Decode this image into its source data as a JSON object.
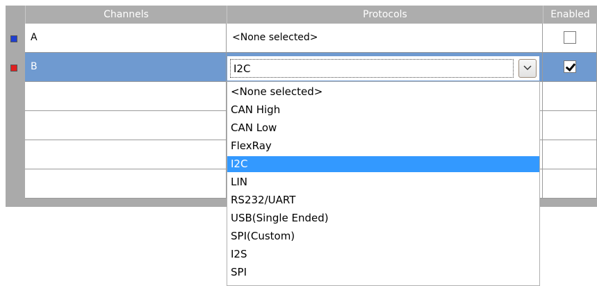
{
  "columns": {
    "channels": "Channels",
    "protocols": "Protocols",
    "enabled": "Enabled"
  },
  "rows": [
    {
      "channel": "A",
      "protocol": "<None selected>",
      "enabled": false,
      "marker_color": "#1f3fd0",
      "selected": false
    },
    {
      "channel": "B",
      "protocol": "I2C",
      "enabled": true,
      "marker_color": "#e02020",
      "selected": true
    }
  ],
  "combo": {
    "value": "I2C"
  },
  "dropdown": {
    "options": [
      "<None selected>",
      "CAN High",
      "CAN Low",
      "FlexRay",
      "I2C",
      "LIN",
      "RS232/UART",
      "USB(Single Ended)",
      "SPI(Custom)",
      "I2S",
      "SPI"
    ],
    "highlighted_index": 4
  },
  "colors": {
    "selected_row": "#6f9ad0",
    "highlight": "#3399ff",
    "header": "#adadad"
  }
}
